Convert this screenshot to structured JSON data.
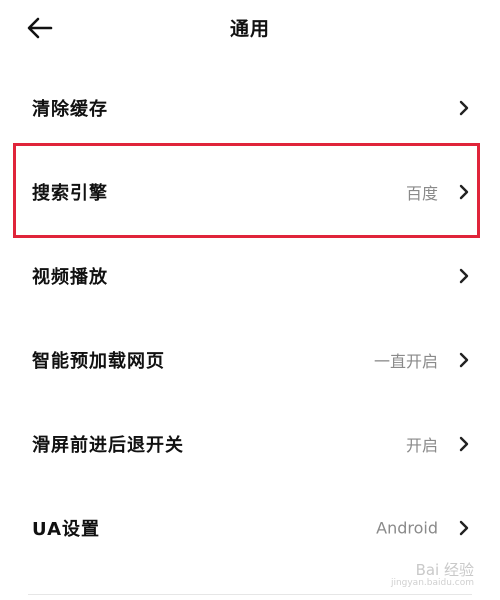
{
  "header": {
    "title": "通用",
    "back_icon": "arrow-left-icon"
  },
  "settings": [
    {
      "label": "清除缓存",
      "value": ""
    },
    {
      "label": "搜索引擎",
      "value": "百度"
    },
    {
      "label": "视频播放",
      "value": ""
    },
    {
      "label": "智能预加载网页",
      "value": "一直开启"
    },
    {
      "label": "滑屏前进后退开关",
      "value": "开启"
    },
    {
      "label": "UA设置",
      "value": "Android"
    }
  ],
  "highlight": {
    "target": "搜索引擎",
    "color": "#e0243a"
  },
  "watermark": {
    "text": "Bai 经验",
    "sub": "jingyan.baidu.com"
  }
}
